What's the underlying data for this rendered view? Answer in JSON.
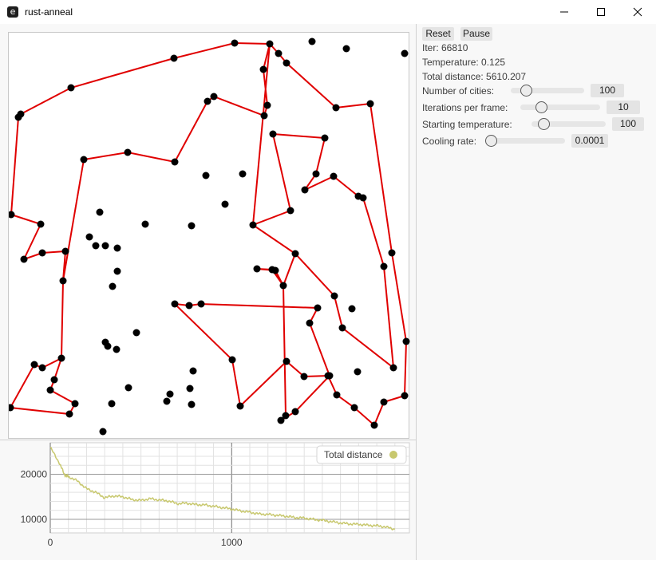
{
  "window": {
    "title": "rust-anneal",
    "app_icon_glyph": "e",
    "controls": [
      "minimize-icon",
      "maximize-icon",
      "close-icon"
    ]
  },
  "controls": {
    "reset_label": "Reset",
    "pause_label": "Pause",
    "iter": "Iter: 66810",
    "temperature": "Temperature: 0.125",
    "total_distance": "Total distance: 5610.207",
    "sliders": [
      {
        "label": "Number of cities:",
        "value": "100",
        "fraction": 0.16
      },
      {
        "label": "Iterations per frame:",
        "value": "10",
        "fraction": 0.22
      },
      {
        "label": "Starting temperature:",
        "value": "100",
        "fraction": 0.1
      },
      {
        "label": "Cooling rate:",
        "value": "0.0001",
        "fraction": 0.0
      }
    ]
  },
  "colors": {
    "route": "#e00000",
    "city": "#000000",
    "series": "#c8c86e"
  },
  "tour": [
    [
      293,
      53
    ],
    [
      337,
      54
    ],
    [
      348,
      66
    ],
    [
      358,
      78
    ],
    [
      420,
      134
    ],
    [
      463,
      129
    ],
    [
      490,
      316
    ],
    [
      508,
      427
    ],
    [
      506,
      495
    ],
    [
      480,
      503
    ],
    [
      468,
      532
    ],
    [
      443,
      510
    ],
    [
      421,
      494
    ],
    [
      410,
      470
    ],
    [
      380,
      471
    ],
    [
      358,
      452
    ],
    [
      300,
      508
    ],
    [
      290,
      450
    ],
    [
      218,
      380
    ],
    [
      236,
      382
    ],
    [
      251,
      380
    ],
    [
      397,
      385
    ],
    [
      387,
      404
    ],
    [
      412,
      470
    ],
    [
      369,
      515
    ],
    [
      351,
      526
    ],
    [
      357,
      520
    ],
    [
      354,
      357
    ],
    [
      344,
      338
    ],
    [
      321,
      336
    ],
    [
      340,
      337
    ],
    [
      354,
      357
    ],
    [
      369,
      317
    ],
    [
      316,
      281
    ],
    [
      363,
      263
    ],
    [
      341,
      167
    ],
    [
      406,
      172
    ],
    [
      395,
      217
    ],
    [
      381,
      237
    ],
    [
      417,
      220
    ],
    [
      448,
      245
    ],
    [
      454,
      247
    ],
    [
      480,
      333
    ],
    [
      492,
      460
    ],
    [
      428,
      410
    ],
    [
      418,
      370
    ],
    [
      369,
      317
    ],
    [
      316,
      281
    ],
    [
      337,
      54
    ],
    [
      329,
      86
    ],
    [
      334,
      131
    ],
    [
      330,
      144
    ],
    [
      267,
      120
    ],
    [
      259,
      126
    ],
    [
      218,
      202
    ],
    [
      159,
      190
    ],
    [
      104,
      199
    ],
    [
      78,
      351
    ],
    [
      76,
      448
    ],
    [
      67,
      475
    ],
    [
      62,
      488
    ],
    [
      93,
      505
    ],
    [
      86,
      518
    ],
    [
      12,
      510
    ],
    [
      42,
      456
    ],
    [
      52,
      460
    ],
    [
      76,
      448
    ],
    [
      78,
      351
    ],
    [
      81,
      314
    ],
    [
      52,
      316
    ],
    [
      29,
      324
    ],
    [
      50,
      280
    ],
    [
      13,
      268
    ],
    [
      22,
      146
    ],
    [
      25,
      142
    ],
    [
      88,
      109
    ],
    [
      217,
      72
    ],
    [
      293,
      53
    ]
  ],
  "cities_extra": [
    [
      390,
      51
    ],
    [
      433,
      60
    ],
    [
      506,
      66
    ],
    [
      303,
      217
    ],
    [
      257,
      219
    ],
    [
      281,
      255
    ],
    [
      239,
      282
    ],
    [
      181,
      280
    ],
    [
      124,
      265
    ],
    [
      111,
      296
    ],
    [
      119,
      307
    ],
    [
      131,
      307
    ],
    [
      146,
      310
    ],
    [
      146,
      339
    ],
    [
      140,
      358
    ],
    [
      131,
      428
    ],
    [
      134,
      433
    ],
    [
      145,
      437
    ],
    [
      170,
      416
    ],
    [
      241,
      464
    ],
    [
      237,
      486
    ],
    [
      212,
      493
    ],
    [
      208,
      502
    ],
    [
      239,
      506
    ],
    [
      160,
      485
    ],
    [
      139,
      505
    ],
    [
      128,
      540
    ],
    [
      440,
      386
    ],
    [
      447,
      465
    ]
  ],
  "chart_data": {
    "type": "line",
    "legend": "Total distance",
    "legend_position": "top-right",
    "xlim": [
      0,
      1980
    ],
    "ylim": [
      7000,
      27000
    ],
    "xticks": [
      0,
      1000
    ],
    "yticks": [
      10000,
      20000
    ],
    "x_tick_labels": [
      "0",
      "1000"
    ],
    "y_tick_labels": [
      "10000",
      "20000"
    ],
    "series": [
      {
        "name": "Total distance",
        "x": [
          0,
          50,
          80,
          100,
          150,
          200,
          250,
          300,
          350,
          400,
          450,
          500,
          550,
          600,
          650,
          700,
          750,
          800,
          850,
          900,
          950,
          1000,
          1050,
          1100,
          1150,
          1200,
          1250,
          1300,
          1350,
          1400,
          1450,
          1500,
          1550,
          1600,
          1650,
          1700,
          1750,
          1800,
          1850,
          1900
        ],
        "y": [
          26000,
          22500,
          19800,
          19500,
          18500,
          16800,
          16000,
          14800,
          15200,
          15000,
          14400,
          14200,
          14600,
          14300,
          14100,
          13500,
          13600,
          13300,
          13200,
          12900,
          12600,
          12300,
          11900,
          11600,
          11200,
          11100,
          10900,
          10700,
          10400,
          10300,
          10000,
          9800,
          9500,
          9200,
          9000,
          8900,
          8700,
          8600,
          8300,
          7800
        ]
      }
    ]
  }
}
